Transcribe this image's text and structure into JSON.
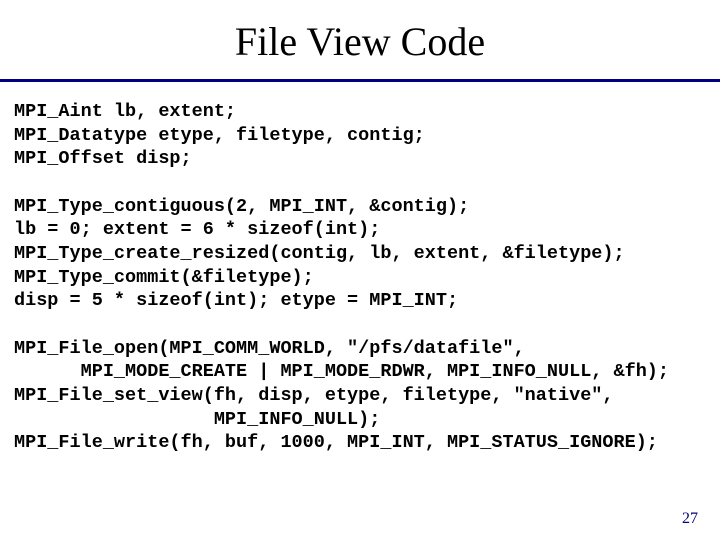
{
  "title": "File View Code",
  "code": {
    "block1": "MPI_Aint lb, extent;\nMPI_Datatype etype, filetype, contig;\nMPI_Offset disp;",
    "block2": "MPI_Type_contiguous(2, MPI_INT, &contig);\nlb = 0; extent = 6 * sizeof(int);\nMPI_Type_create_resized(contig, lb, extent, &filetype);\nMPI_Type_commit(&filetype);\ndisp = 5 * sizeof(int); etype = MPI_INT;",
    "block3": "MPI_File_open(MPI_COMM_WORLD, \"/pfs/datafile\",\n      MPI_MODE_CREATE | MPI_MODE_RDWR, MPI_INFO_NULL, &fh);\nMPI_File_set_view(fh, disp, etype, filetype, \"native\",\n                  MPI_INFO_NULL);\nMPI_File_write(fh, buf, 1000, MPI_INT, MPI_STATUS_IGNORE);"
  },
  "page_number": "27"
}
